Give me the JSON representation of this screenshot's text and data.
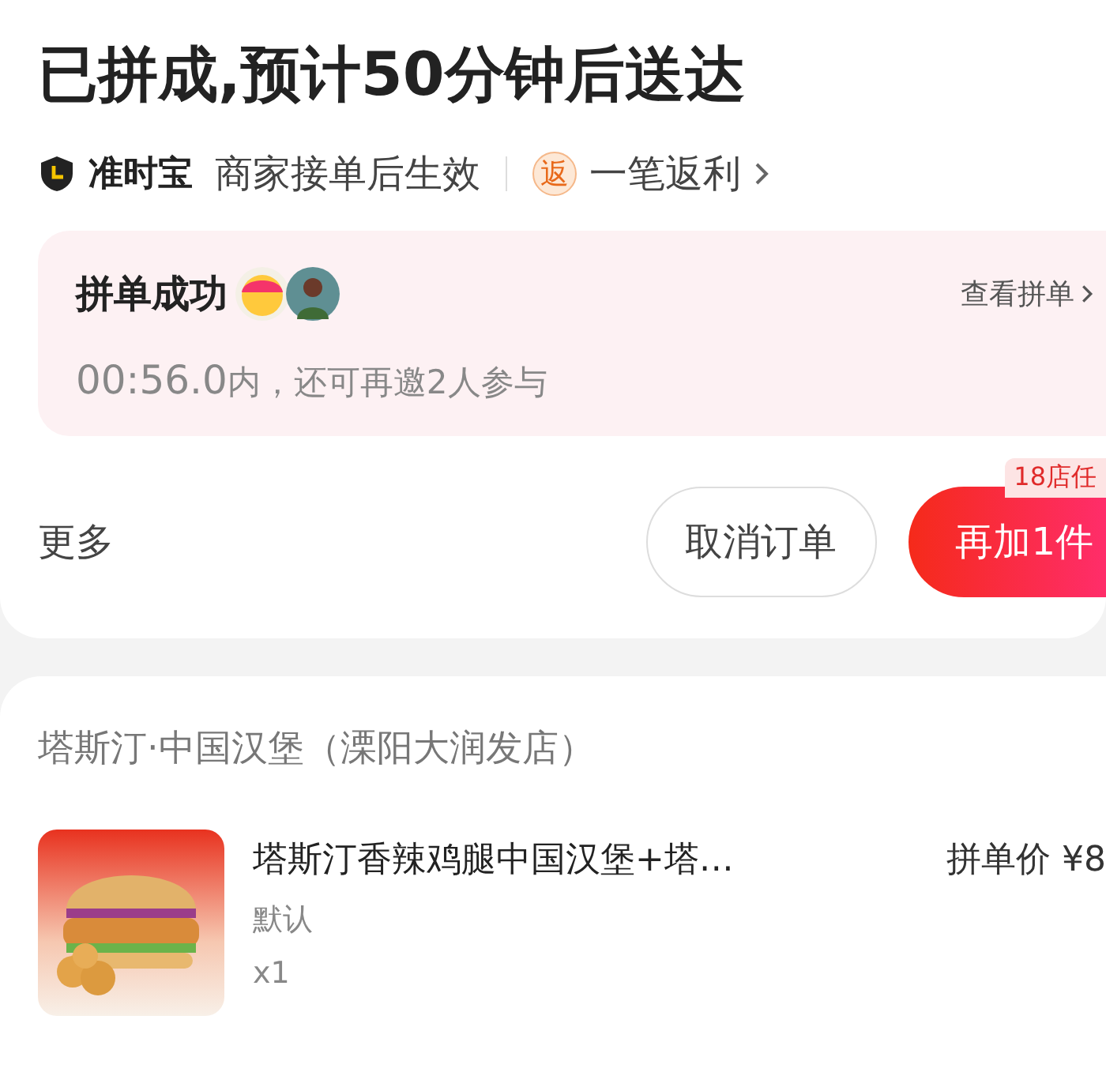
{
  "header": {
    "title": "已拼成,预计50分钟后送达"
  },
  "guarantee": {
    "badge": "准时宝",
    "note": "商家接单后生效",
    "rebate_icon": "返",
    "rebate": "一笔返利"
  },
  "group": {
    "title": "拼单成功",
    "members": [
      {
        "kind": "emoji"
      },
      {
        "kind": "person"
      }
    ],
    "link": "查看拼单",
    "countdown": "00:56.0",
    "invite": "内，还可再邀2人参与"
  },
  "actions": {
    "more": "更多",
    "buttons": [
      {
        "label": "取消订单",
        "kind": "secondary"
      },
      {
        "label": "再加1件",
        "kind": "primary",
        "badge": "18店任"
      }
    ]
  },
  "store": {
    "name": "塔斯汀·中国汉堡（溧阳大润发店）",
    "items": [
      {
        "name": "塔斯汀香辣鸡腿中国汉堡+塔…",
        "spec": "默认",
        "qty": "x1",
        "price_label": "拼单价",
        "price": "¥8"
      }
    ]
  }
}
